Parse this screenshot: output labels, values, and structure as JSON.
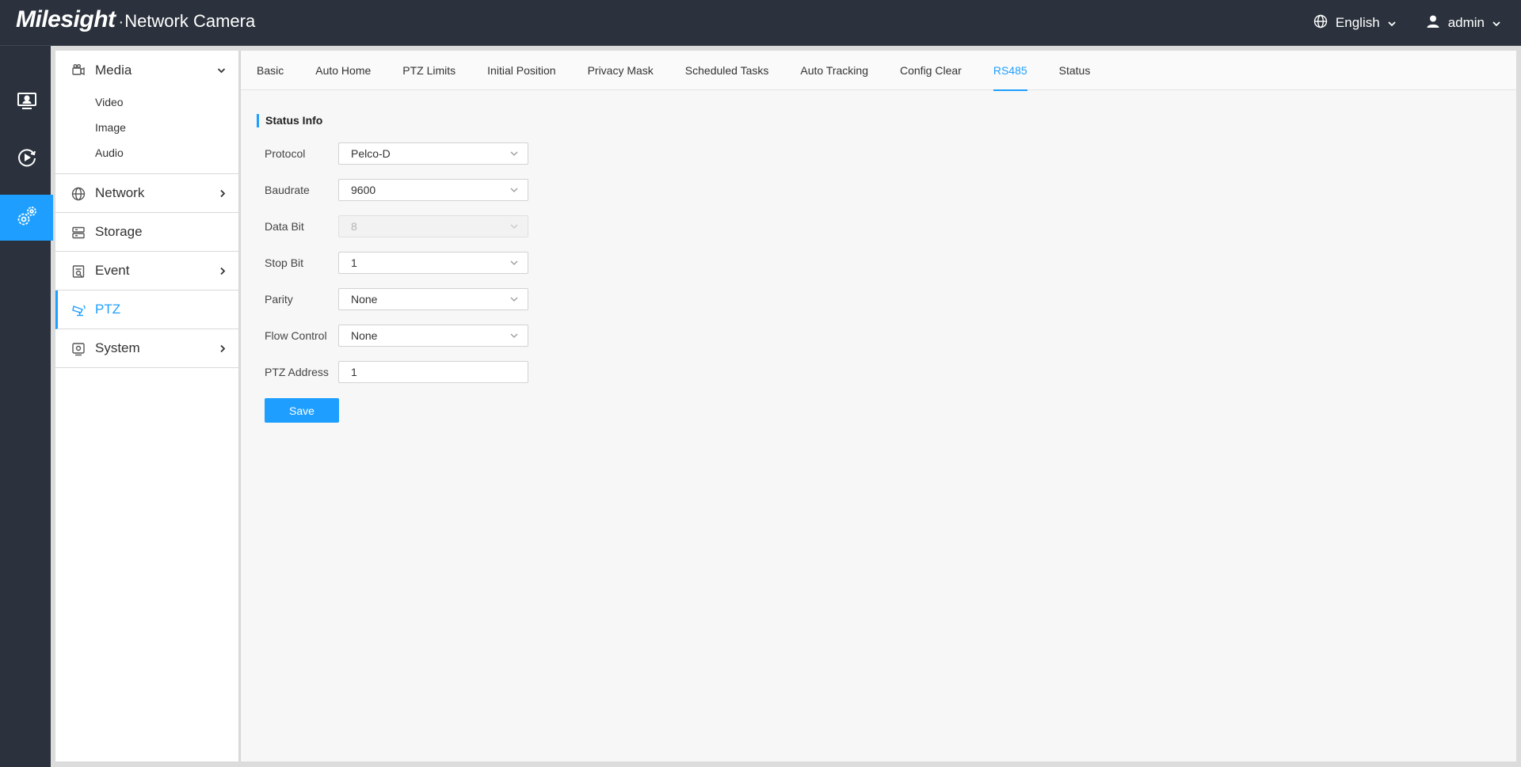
{
  "brand": {
    "logo": "Milesight",
    "dot": "·",
    "product": "Network Camera"
  },
  "header": {
    "language": "English",
    "user": "admin"
  },
  "rail": {
    "items": [
      {
        "icon": "live-view-icon",
        "active": false
      },
      {
        "icon": "playback-icon",
        "active": false
      },
      {
        "icon": "settings-icon",
        "active": true
      }
    ]
  },
  "sidebar": {
    "media": {
      "label": "Media",
      "icon": "camera-icon",
      "expanded": true,
      "sub": [
        "Video",
        "Image",
        "Audio"
      ]
    },
    "network": {
      "label": "Network",
      "icon": "globe-icon"
    },
    "storage": {
      "label": "Storage",
      "icon": "storage-icon"
    },
    "event": {
      "label": "Event",
      "icon": "event-icon"
    },
    "ptz": {
      "label": "PTZ",
      "icon": "ptz-camera-icon",
      "active": true
    },
    "system": {
      "label": "System",
      "icon": "system-icon"
    }
  },
  "tabs": [
    "Basic",
    "Auto Home",
    "PTZ Limits",
    "Initial Position",
    "Privacy Mask",
    "Scheduled Tasks",
    "Auto Tracking",
    "Config Clear",
    "RS485",
    "Status"
  ],
  "active_tab": "RS485",
  "section_title": "Status Info",
  "form": {
    "protocol": {
      "label": "Protocol",
      "value": "Pelco-D"
    },
    "baudrate": {
      "label": "Baudrate",
      "value": "9600"
    },
    "data_bit": {
      "label": "Data Bit",
      "value": "8",
      "disabled": true
    },
    "stop_bit": {
      "label": "Stop Bit",
      "value": "1"
    },
    "parity": {
      "label": "Parity",
      "value": "None"
    },
    "flow_control": {
      "label": "Flow Control",
      "value": "None"
    },
    "ptz_address": {
      "label": "PTZ Address",
      "value": "1"
    }
  },
  "save_label": "Save",
  "colors": {
    "accent": "#1e9fff",
    "topbar": "#2b323d"
  }
}
